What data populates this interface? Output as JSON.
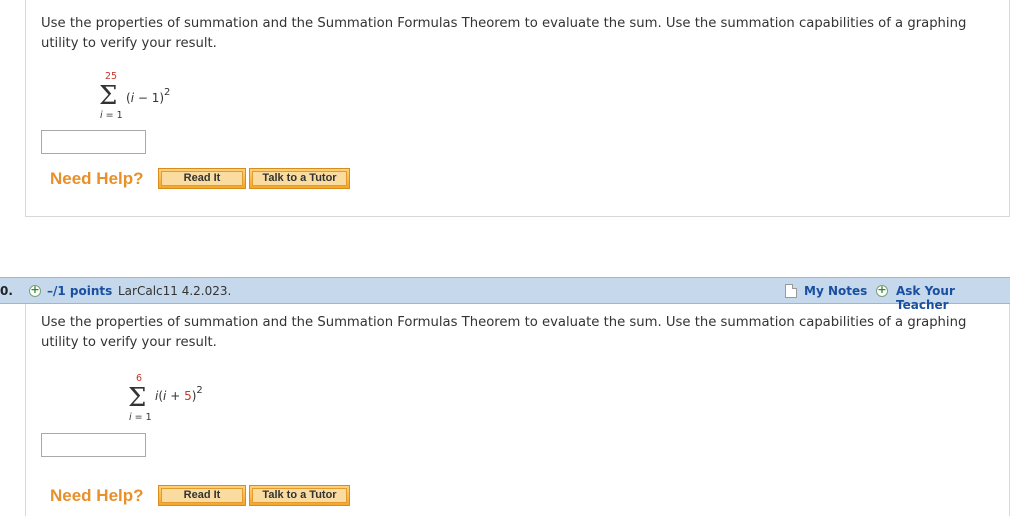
{
  "question1": {
    "prompt": "Use the properties of summation and the Summation Formulas Theorem to evaluate the sum. Use the summation capabilities of a graphing utility to verify your result.",
    "sum_upper": "25",
    "sum_lower_var": "i",
    "sum_lower_value": " = 1",
    "expr_open": "(",
    "expr_var": "i",
    "expr_rest": " − 1)",
    "expr_power": "2",
    "answer_value": "",
    "need_help_label": "Need Help?",
    "read_it_label": "Read It",
    "talk_tutor_label": "Talk to a Tutor"
  },
  "question2": {
    "number": "0.",
    "points": "–/1 points",
    "source": "LarCalc11 4.2.023.",
    "my_notes_label": "My Notes",
    "ask_teacher_label": "Ask Your Teacher",
    "prompt": "Use the properties of summation and the Summation Formulas Theorem to evaluate the sum. Use the summation capabilities of a graphing utility to verify your result.",
    "sum_upper": "6",
    "sum_lower_var": "i",
    "sum_lower_value": " = 1",
    "expr_var1": "i",
    "expr_open": "(",
    "expr_var2": "i",
    "expr_plus": " + ",
    "expr_const": "5",
    "expr_close": ")",
    "expr_power": "2",
    "answer_value": "",
    "need_help_label": "Need Help?",
    "read_it_label": "Read It",
    "talk_tutor_label": "Talk to a Tutor"
  },
  "colors": {
    "header_bg": "#c5d8ec",
    "link": "#1a4fa0",
    "need_help": "#e8902a",
    "button_orange": "#f4a62a",
    "limit_red": "#c0392b"
  },
  "icons": [
    "plus-circle-icon",
    "note-icon",
    "sigma-icon"
  ]
}
